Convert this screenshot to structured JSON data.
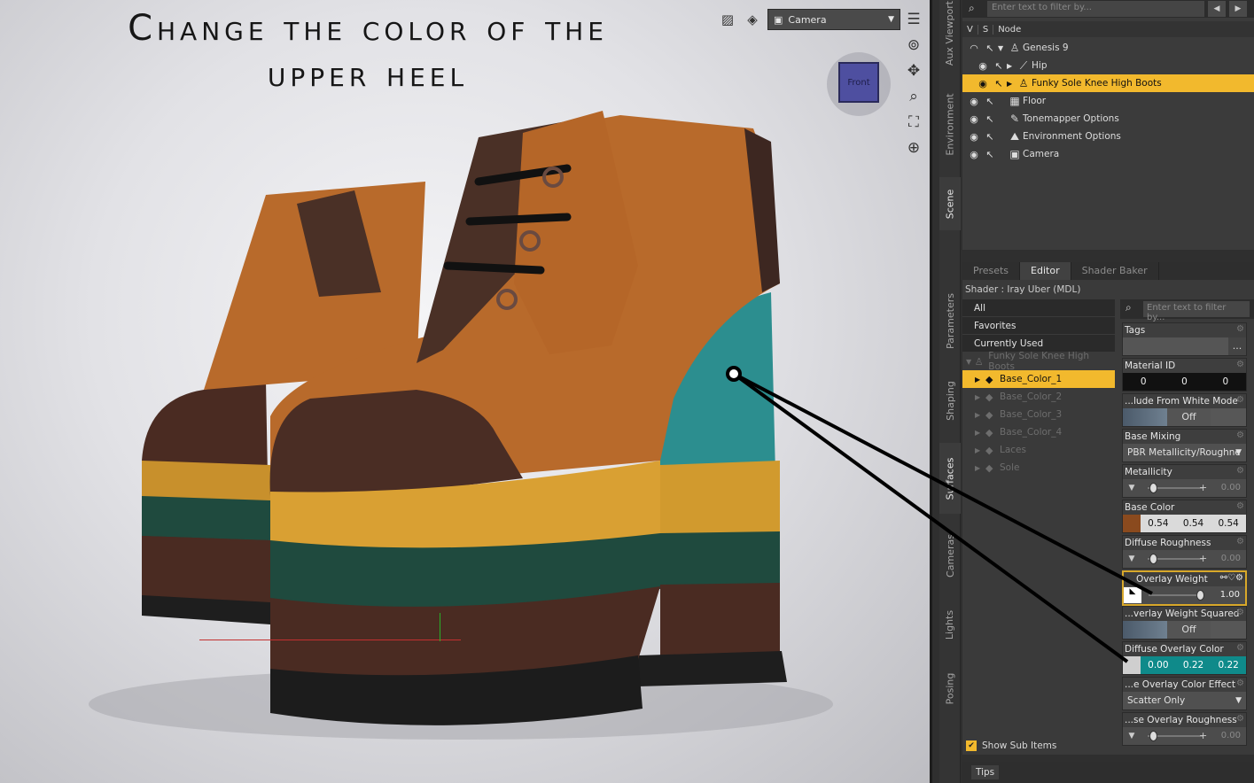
{
  "viewport": {
    "title": "Change the color of the\nupper heel",
    "camera": "Camera",
    "view_cube_label": "Front"
  },
  "side_tabs": [
    "Aux Viewport",
    "Environment",
    "Scene",
    "Parameters",
    "Shaping",
    "Surfaces",
    "Cameras",
    "Lights",
    "Posing"
  ],
  "scene": {
    "search_placeholder": "Enter text to filter by...",
    "col_v": "V",
    "col_s": "S",
    "col_node": "Node",
    "nodes": [
      {
        "label": "Genesis 9",
        "icon": "figure-icon"
      },
      {
        "label": "Hip",
        "icon": "bone-icon"
      },
      {
        "label": "Funky Sole Knee High Boots",
        "icon": "figure-icon"
      },
      {
        "label": "Floor",
        "icon": "cube-icon"
      },
      {
        "label": "Tonemapper Options",
        "icon": "tonemapper-icon"
      },
      {
        "label": "Environment Options",
        "icon": "environment-icon"
      },
      {
        "label": "Camera",
        "icon": "camera-icon"
      }
    ]
  },
  "editor": {
    "tabs": [
      "Presets",
      "Editor",
      "Shader Baker"
    ],
    "shader": "Shader : Iray Uber (MDL)",
    "filters": [
      "All",
      "Favorites",
      "Currently Used"
    ],
    "figure": "Funky Sole Knee High Boots",
    "materials": [
      "Base_Color_1",
      "Base_Color_2",
      "Base_Color_3",
      "Base_Color_4",
      "Laces",
      "Sole"
    ],
    "show_sub_items": "Show Sub Items",
    "prop_search_placeholder": "Enter text to filter by...",
    "props": {
      "tags": "Tags",
      "tags_btn": "...",
      "material_id": "Material ID",
      "material_id_vals": [
        "0",
        "0",
        "0"
      ],
      "exclude_white": "...lude From White Mode",
      "exclude_white_val": "Off",
      "base_mixing": "Base Mixing",
      "base_mixing_val": "PBR Metallicity/Roughne",
      "metallicity": "Metallicity",
      "metallicity_val": "0.00",
      "base_color": "Base Color",
      "base_color_vals": [
        "0.54",
        "0.54",
        "0.54"
      ],
      "diffuse_roughness": "Diffuse Roughness",
      "diffuse_roughness_val": "0.00",
      "overlay_weight": "Overlay Weight",
      "overlay_weight_val": "1.00",
      "overlay_weight_sq": "...verlay Weight Squared",
      "overlay_weight_sq_val": "Off",
      "diffuse_overlay_color": "Diffuse Overlay Color",
      "diffuse_overlay_vals": [
        "0.00",
        "0.22",
        "0.22"
      ],
      "overlay_color_effect": "...e Overlay Color Effect",
      "overlay_color_effect_val": "Scatter Only",
      "overlay_roughness": "...se Overlay Roughness",
      "overlay_roughness_val": "0.00"
    }
  },
  "tips_tab": "Tips",
  "colors": {
    "selection": "#f2b92d",
    "overlay_teal": "#0f8a8a"
  }
}
